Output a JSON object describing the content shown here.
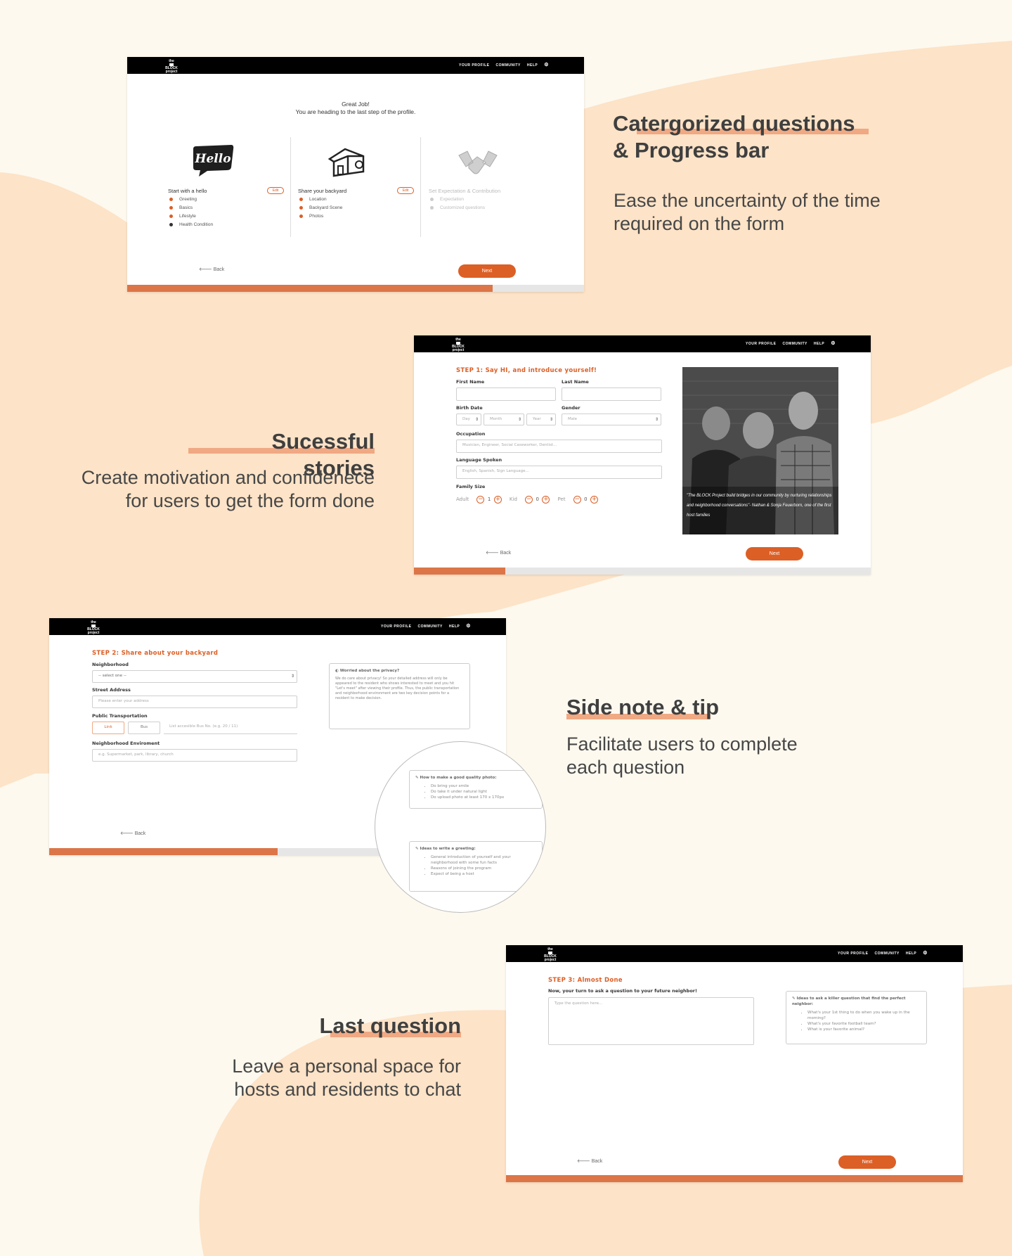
{
  "colors": {
    "accent": "#dc5f26",
    "progress": "#dc7547",
    "blob": "#fde3c7",
    "cream": "#fdf9ef"
  },
  "nav": {
    "logo_top": "the",
    "logo_main": "BLOCK",
    "logo_bottom": "project",
    "links": [
      "YOUR PROFILE",
      "COMMUNITY",
      "HELP"
    ],
    "settings_icon": "gear-icon"
  },
  "common": {
    "back_label": "Back",
    "next_label": "Next"
  },
  "screen1": {
    "greeting_line1": "Great Job!",
    "greeting_line2": "You are heading to the last step of the profile.",
    "progress": 0.8,
    "categories": [
      {
        "icon": "hello-speech-bubble-icon",
        "title": "Start with a hello",
        "edit": "Edit",
        "items": [
          "Greeting",
          "Basics",
          "Lifestyle",
          "Health Condition"
        ]
      },
      {
        "icon": "house-icon",
        "title": "Share your backyard",
        "edit": "Edit",
        "items": [
          "Location",
          "Backyard Scene",
          "Photos"
        ]
      },
      {
        "icon": "handshake-icon",
        "title": "Set Expectation & Contribution",
        "items": [
          "Expectation",
          "Customized questions"
        ]
      }
    ],
    "hello_text": "Hello"
  },
  "screen2": {
    "step_title": "STEP 1: Say HI, and introduce yourself!",
    "progress": 0.2,
    "first_name_label": "First Name",
    "last_name_label": "Last Name",
    "birth_date_label": "Birth Date",
    "day": "Day",
    "month": "Month",
    "year": "Year",
    "gender_label": "Gender",
    "gender_value": "Male",
    "occupation_label": "Occupation",
    "occupation_placeholder": "Musician, Engineer, Social Caseworker, Dentist...",
    "language_label": "Language Spoken",
    "language_placeholder": "English, Spanish, Sign Language...",
    "family_label": "Family Size",
    "adult_label": "Adult",
    "adult_value": "1",
    "kid_label": "Kid",
    "kid_value": "0",
    "pet_label": "Pet",
    "pet_value": "0",
    "quote": "\"The BLOCK Project build bridges in our community by nurturing relationships and neighborhood conversations\"- Nathan & Sonja Feuerborn, one of the first host families"
  },
  "screen3": {
    "step_title": "STEP 2: Share about your backyard",
    "progress": 0.5,
    "neighborhood_label": "Neighborhood",
    "neighborhood_value": "-- select one --",
    "street_label": "Street Address",
    "street_placeholder": "Please enter your address",
    "transport_label": "Public Transportation",
    "link_rail_label": "Link",
    "bus_label": "Bus",
    "bus_placeholder": "List accesible Bus No. (e.g. 20 / 11)",
    "env_label": "Neighborhood Enviroment",
    "env_placeholder": "e.g. Supermarket, park, library, church",
    "privacy_title": "Worried about the privacy?",
    "privacy_text": "We do care about privacy! So your detailed address will only be appeared to the resident who shows interested to meet and you hit \"Let's meet\" after viewing their profile. Thus, the public transportation and neighborhood environment are two key decision points for a resident to make decision.",
    "photo_tip_title": "How to make a good quality photo:",
    "photo_tips": [
      "Do bring your smile",
      "Do take it under natural light",
      "Do upload photo at least 170 x 170px"
    ],
    "greeting_tip_title": "Ideas to write a greeting:",
    "greeting_tips": [
      "General introduction of yourself and your neighborhood with some fun facts",
      "Reasons of joining the program",
      "Expect of being a host"
    ]
  },
  "screen4": {
    "step_title": "STEP 3: Almost Done",
    "question_label": "Now, your turn to ask a question to your future neighbor!",
    "question_placeholder": "Type the question here...",
    "progress": 1.0,
    "tip_title": "Ideas to ask a killer question that find the perfect neighbor:",
    "tips": [
      "What's your 1st thing to do when you wake up in the morning?",
      "What's your favorite football team?",
      "What is your favorite animal?"
    ]
  },
  "features": [
    {
      "title_line1": "Catergorized questions",
      "title_line2": "& Progress bar",
      "desc_line1": "Ease the uncertainty of the time",
      "desc_line2": "required on the form"
    },
    {
      "title_line1": "Sucessful stories",
      "desc_line1": "Create motivation and confidenece",
      "desc_line2": "for users to get the form done"
    },
    {
      "title_line1": "Side note & tip",
      "desc_line1": "Facilitate users to complete",
      "desc_line2": "each question"
    },
    {
      "title_line1": "Last question",
      "desc_line1": "Leave a personal space for",
      "desc_line2": "hosts and residents to chat"
    }
  ]
}
